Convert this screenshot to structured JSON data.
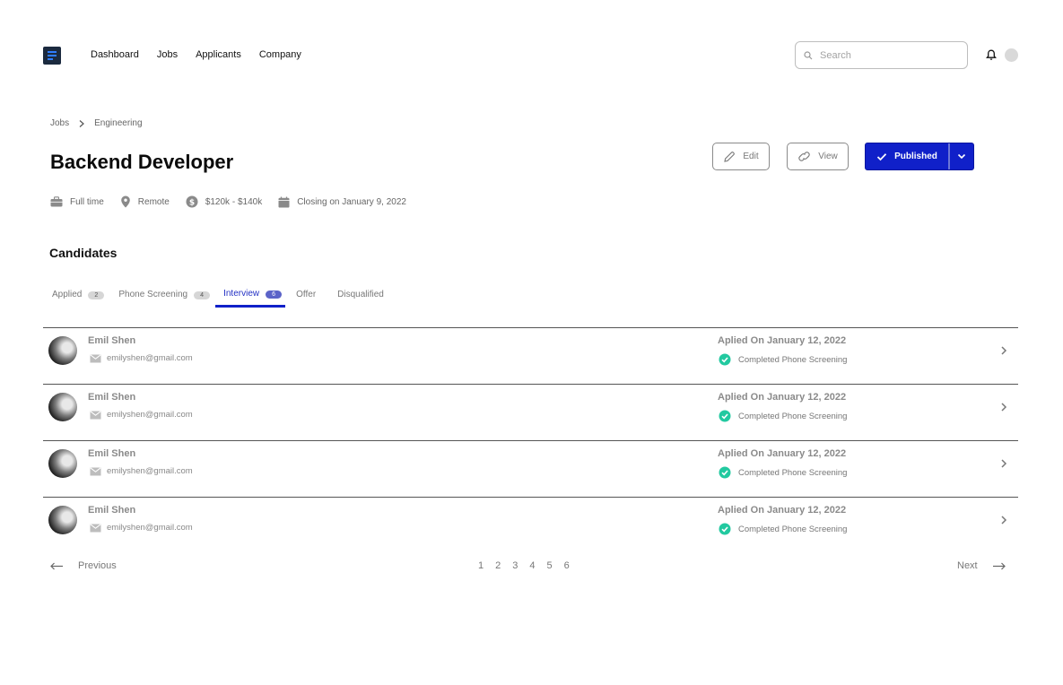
{
  "nav": {
    "items": [
      "Dashboard",
      "Jobs",
      "Applicants",
      "Company"
    ]
  },
  "search": {
    "placeholder": "Search",
    "value": ""
  },
  "breadcrumb": [
    "Jobs",
    "Engineering"
  ],
  "job": {
    "title": "Backend Developer",
    "employment_type": "Full time",
    "location": "Remote",
    "salary": "$120k - $140k",
    "closing": "Closing on January 9, 2022"
  },
  "actions": {
    "edit_label": "Edit",
    "view_label": "View",
    "publish_label": "Published",
    "accent_color": "#1020c9"
  },
  "candidates": {
    "title": "Candidates",
    "tabs": [
      {
        "label": "Applied",
        "count": "2"
      },
      {
        "label": "Phone Screening",
        "count": "4"
      },
      {
        "label": "Interview",
        "count": "6",
        "active": true
      },
      {
        "label": "Offer"
      },
      {
        "label": "Disqualified"
      }
    ],
    "rows": [
      {
        "name": "Emil Shen",
        "email": "emilyshen@gmail.com",
        "applied": "Aplied On January 12, 2022",
        "status": "Completed Phone Screening"
      },
      {
        "name": "Emil Shen",
        "email": "emilyshen@gmail.com",
        "applied": "Aplied On January 12, 2022",
        "status": "Completed Phone Screening"
      },
      {
        "name": "Emil Shen",
        "email": "emilyshen@gmail.com",
        "applied": "Aplied On January 12, 2022",
        "status": "Completed Phone Screening"
      },
      {
        "name": "Emil Shen",
        "email": "emilyshen@gmail.com",
        "applied": "Aplied On January 12, 2022",
        "status": "Completed Phone Screening"
      }
    ],
    "status_color": "#22c9a0"
  },
  "pagination": {
    "previous_label": "Previous",
    "next_label": "Next",
    "pages": [
      "1",
      "2",
      "3",
      "4",
      "5",
      "6"
    ]
  }
}
